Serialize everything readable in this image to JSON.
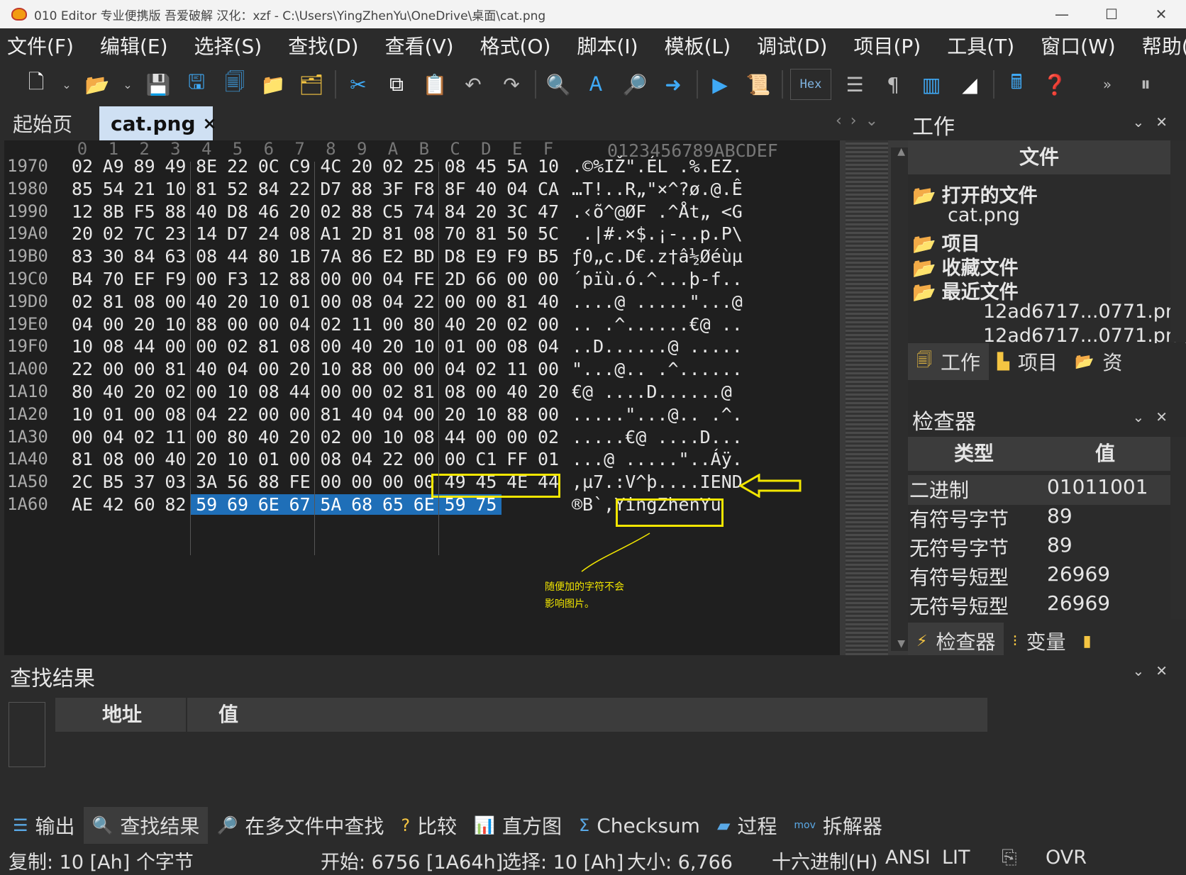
{
  "window": {
    "title": "010 Editor 专业便携版 吾爱破解  汉化：xzf - C:\\Users\\YingZhenYu\\OneDrive\\桌面\\cat.png",
    "controls": [
      "—",
      "☐",
      "✕"
    ]
  },
  "menu": [
    "文件(F)",
    "编辑(E)",
    "选择(S)",
    "查找(D)",
    "查看(V)",
    "格式(O)",
    "脚本(I)",
    "模板(L)",
    "调试(D)",
    "项目(P)",
    "工具(T)",
    "窗口(W)",
    "帮助(H)"
  ],
  "toolbar": {
    "hex_label": "Hex"
  },
  "tabs": {
    "start": "起始页",
    "active": "cat.png",
    "close": "×"
  },
  "hex": {
    "col_headers": [
      "0",
      "1",
      "2",
      "3",
      "4",
      "5",
      "6",
      "7",
      "8",
      "9",
      "A",
      "B",
      "C",
      "D",
      "E",
      "F"
    ],
    "ascii_header": "0123456789ABCDEF",
    "rows": [
      {
        "addr": "1970",
        "bytes": [
          "02",
          "A9",
          "89",
          "49",
          "8E",
          "22",
          "0C",
          "C9",
          "4C",
          "20",
          "02",
          "25",
          "08",
          "45",
          "5A",
          "10"
        ],
        "ascii": ".©%IŽ\".ÉL .%.EZ."
      },
      {
        "addr": "1980",
        "bytes": [
          "85",
          "54",
          "21",
          "10",
          "81",
          "52",
          "84",
          "22",
          "D7",
          "88",
          "3F",
          "F8",
          "8F",
          "40",
          "04",
          "CA"
        ],
        "ascii": "…T!..R„\"×^?ø.@.Ê"
      },
      {
        "addr": "1990",
        "bytes": [
          "12",
          "8B",
          "F5",
          "88",
          "40",
          "D8",
          "46",
          "20",
          "02",
          "88",
          "C5",
          "74",
          "84",
          "20",
          "3C",
          "47"
        ],
        "ascii": ".‹õ^@ØF .^Åt„ <G"
      },
      {
        "addr": "19A0",
        "bytes": [
          "20",
          "02",
          "7C",
          "23",
          "14",
          "D7",
          "24",
          "08",
          "A1",
          "2D",
          "81",
          "08",
          "70",
          "81",
          "50",
          "5C"
        ],
        "ascii": " .|#.×$.¡-..p.P\\"
      },
      {
        "addr": "19B0",
        "bytes": [
          "83",
          "30",
          "84",
          "63",
          "08",
          "44",
          "80",
          "1B",
          "7A",
          "86",
          "E2",
          "BD",
          "D8",
          "E9",
          "F9",
          "B5"
        ],
        "ascii": "ƒ0„c.D€.z†â½Øéùµ"
      },
      {
        "addr": "19C0",
        "bytes": [
          "B4",
          "70",
          "EF",
          "F9",
          "00",
          "F3",
          "12",
          "88",
          "00",
          "00",
          "04",
          "FE",
          "2D",
          "66",
          "00",
          "00"
        ],
        "ascii": "´pïù.ó.^...þ-f.."
      },
      {
        "addr": "19D0",
        "bytes": [
          "02",
          "81",
          "08",
          "00",
          "40",
          "20",
          "10",
          "01",
          "00",
          "08",
          "04",
          "22",
          "00",
          "00",
          "81",
          "40"
        ],
        "ascii": "....@ .....\"...@"
      },
      {
        "addr": "19E0",
        "bytes": [
          "04",
          "00",
          "20",
          "10",
          "88",
          "00",
          "00",
          "04",
          "02",
          "11",
          "00",
          "80",
          "40",
          "20",
          "02",
          "00"
        ],
        "ascii": ".. .^......€@ .."
      },
      {
        "addr": "19F0",
        "bytes": [
          "10",
          "08",
          "44",
          "00",
          "00",
          "02",
          "81",
          "08",
          "00",
          "40",
          "20",
          "10",
          "01",
          "00",
          "08",
          "04"
        ],
        "ascii": "..D......@ ....."
      },
      {
        "addr": "1A00",
        "bytes": [
          "22",
          "00",
          "00",
          "81",
          "40",
          "04",
          "00",
          "20",
          "10",
          "88",
          "00",
          "00",
          "04",
          "02",
          "11",
          "00"
        ],
        "ascii": "\"...@.. .^......"
      },
      {
        "addr": "1A10",
        "bytes": [
          "80",
          "40",
          "20",
          "02",
          "00",
          "10",
          "08",
          "44",
          "00",
          "00",
          "02",
          "81",
          "08",
          "00",
          "40",
          "20"
        ],
        "ascii": "€@ ....D......@ "
      },
      {
        "addr": "1A20",
        "bytes": [
          "10",
          "01",
          "00",
          "08",
          "04",
          "22",
          "00",
          "00",
          "81",
          "40",
          "04",
          "00",
          "20",
          "10",
          "88",
          "00"
        ],
        "ascii": ".....\"...@.. .^."
      },
      {
        "addr": "1A30",
        "bytes": [
          "00",
          "04",
          "02",
          "11",
          "00",
          "80",
          "40",
          "20",
          "02",
          "00",
          "10",
          "08",
          "44",
          "00",
          "00",
          "02"
        ],
        "ascii": ".....€@ ....D..."
      },
      {
        "addr": "1A40",
        "bytes": [
          "81",
          "08",
          "00",
          "40",
          "20",
          "10",
          "01",
          "00",
          "08",
          "04",
          "22",
          "00",
          "00",
          "C1",
          "FF",
          "01"
        ],
        "ascii": "...@ .....\"..Áÿ."
      },
      {
        "addr": "1A50",
        "bytes": [
          "2C",
          "B5",
          "37",
          "03",
          "3A",
          "56",
          "88",
          "FE",
          "00",
          "00",
          "00",
          "00",
          "49",
          "45",
          "4E",
          "44"
        ],
        "ascii": ",µ7.:V^þ....IEND"
      },
      {
        "addr": "1A60",
        "bytes": [
          "AE",
          "42",
          "60",
          "82",
          "59",
          "69",
          "6E",
          "67",
          "5A",
          "68",
          "65",
          "6E",
          "59",
          "75"
        ],
        "ascii": "®B`‚YingZhenYu"
      }
    ],
    "annotation_note": [
      "随便加的字符不会",
      "影响图片。"
    ]
  },
  "work_dock": {
    "title": "工作",
    "header": "文件",
    "tree": [
      {
        "label": "打开的文件",
        "bold": true,
        "indent": 0
      },
      {
        "label": "cat.png",
        "bold": false,
        "indent": 1
      },
      {
        "label": "项目",
        "bold": true,
        "indent": 0
      },
      {
        "label": "收藏文件",
        "bold": true,
        "indent": 0
      },
      {
        "label": "最近文件",
        "bold": true,
        "indent": 0
      },
      {
        "label": "12ad6717...0771.png",
        "bold": false,
        "indent": 2
      },
      {
        "label": "12ad6717...0771.png",
        "bold": false,
        "indent": 2
      }
    ],
    "tabs": [
      "工作",
      "项目",
      "资"
    ]
  },
  "inspector": {
    "title": "检查器",
    "col_type": "类型",
    "col_value": "值",
    "rows": [
      {
        "k": "二进制",
        "v": "01011001"
      },
      {
        "k": "有符号字节",
        "v": "89"
      },
      {
        "k": "无符号字节",
        "v": "89"
      },
      {
        "k": "有符号短型",
        "v": "26969"
      },
      {
        "k": "无符号短型",
        "v": "26969"
      }
    ],
    "tabs": [
      "检查器",
      "变量"
    ]
  },
  "find": {
    "title": "查找结果",
    "col_addr": "地址",
    "col_value": "值"
  },
  "bottom_tabs": [
    "输出",
    "查找结果",
    "在多文件中查找",
    "比较",
    "直方图",
    "Checksum",
    "过程",
    "拆解器"
  ],
  "status": {
    "copy": "复制: 10 [Ah] 个字节",
    "start": "开始: 6756 [1A64h]",
    "select": "选择: 10 [Ah]",
    "size": "大小:   6,766",
    "mode": "十六进制(H)",
    "encoding": "ANSI",
    "endian": "LIT",
    "ovr": "OVR"
  },
  "colors": {
    "selection": "#1f6fb8",
    "highlight": "#f2e600",
    "tab_active": "#cfe0f3"
  }
}
